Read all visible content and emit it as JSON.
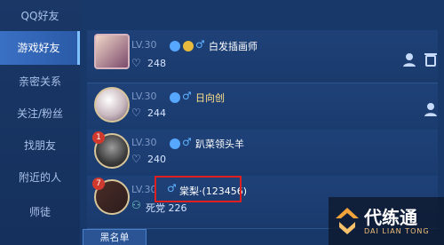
{
  "sidebar": {
    "items": [
      {
        "label": "QQ好友"
      },
      {
        "label": "游戏好友",
        "active": true
      },
      {
        "label": "亲密关系"
      },
      {
        "label": "关注/粉丝"
      },
      {
        "label": "找朋友"
      },
      {
        "label": "附近的人"
      },
      {
        "label": "师徒"
      }
    ]
  },
  "friends": [
    {
      "level": "LV.30",
      "name": "白发插画师",
      "stat": "248",
      "stat_icon": "heart-icon"
    },
    {
      "level": "LV.30",
      "name": "日向创",
      "stat": "244",
      "stat_icon": "heart-icon"
    },
    {
      "level": "LV.30",
      "name": "趴菜领头羊",
      "stat": "240",
      "stat_icon": "heart-icon",
      "rank_badge": "1"
    },
    {
      "level": "LV.30",
      "name": "棠梨·(123456)",
      "stat": "死党 226",
      "stat_icon": "friend-icon",
      "rank_badge": "7"
    }
  ],
  "buttons": {
    "blacklist": "黑名单"
  },
  "watermark": {
    "main": "代练通",
    "sub": "DAI LIAN TONG"
  },
  "colors": {
    "highlight": "#e01f1f",
    "accent": "#3a70c4"
  }
}
